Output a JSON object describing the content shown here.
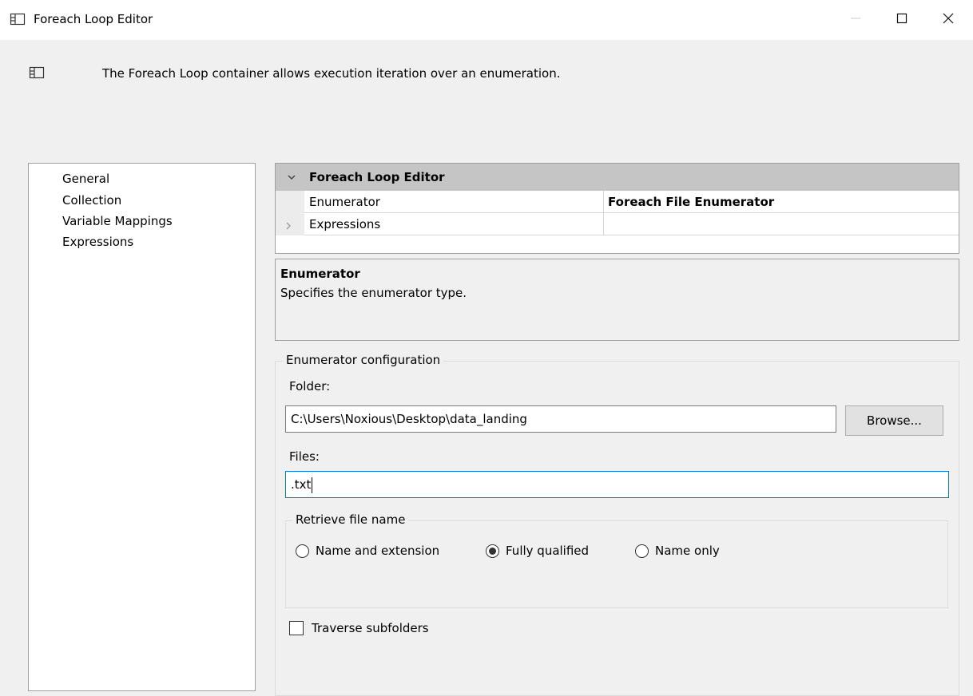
{
  "window": {
    "title": "Foreach Loop Editor",
    "app_icon": "container-icon",
    "controls": {
      "minimize": "minimize-icon",
      "maximize": "maximize-icon",
      "close": "close-icon"
    }
  },
  "header": {
    "icon": "container-icon",
    "description": "The Foreach Loop container allows execution iteration over an enumeration."
  },
  "nav": {
    "items": [
      {
        "label": "General"
      },
      {
        "label": "Collection",
        "selected": true
      },
      {
        "label": "Variable Mappings"
      },
      {
        "label": "Expressions"
      }
    ]
  },
  "property_grid": {
    "category": "Foreach Loop Editor",
    "rows": [
      {
        "name": "Enumerator",
        "value": "Foreach File Enumerator"
      },
      {
        "name": "Expressions",
        "value": ""
      }
    ]
  },
  "description_box": {
    "title": "Enumerator",
    "text": "Specifies the enumerator type."
  },
  "config": {
    "legend": "Enumerator configuration",
    "folder_label": "Folder:",
    "folder_value": "C:\\Users\\Noxious\\Desktop\\data_landing",
    "browse_label": "Browse...",
    "files_label": "Files:",
    "files_value": ".txt",
    "retrieve": {
      "legend": "Retrieve file name",
      "options": [
        {
          "label": "Name and extension",
          "selected": false
        },
        {
          "label": "Fully qualified",
          "selected": true
        },
        {
          "label": "Name only",
          "selected": false
        }
      ]
    },
    "traverse_label": "Traverse subfolders",
    "traverse_checked": false
  },
  "colors": {
    "background": "#f0f0f0",
    "category_header": "#c5c5c5",
    "focus_border": "#0078d7"
  }
}
